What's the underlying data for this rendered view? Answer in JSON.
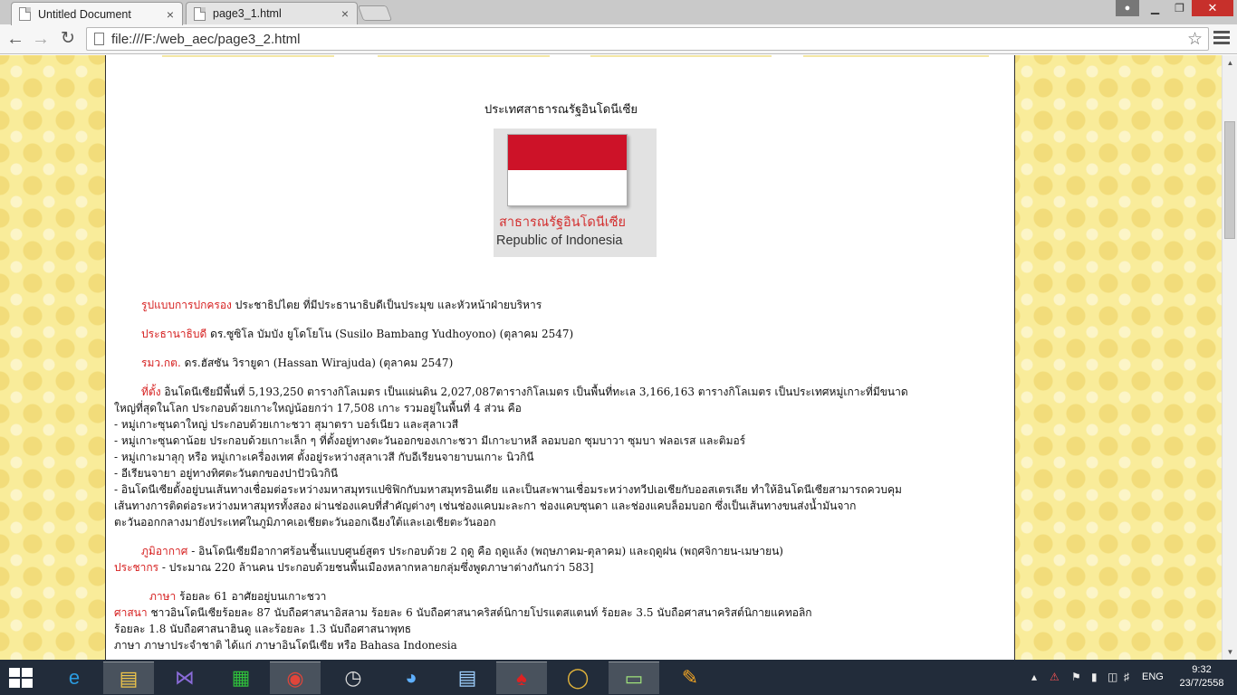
{
  "browser": {
    "tabs": [
      {
        "title": "Untitled Document",
        "active": true
      },
      {
        "title": "page3_1.html",
        "active": false
      }
    ],
    "tab_close": "×",
    "address": "file:///F:/web_aec/page3_2.html",
    "window_user_icon": "user-icon",
    "window_buttons": {
      "minimize": "▁",
      "maximize": "❐",
      "close": "✕"
    }
  },
  "page": {
    "country_title": "ประเทศสาธารณรัฐอินโดนีเซีย",
    "flag": {
      "colors": {
        "top": "#cd1228",
        "bottom": "#ffffff"
      },
      "caption_th": "สาธารณรัฐอินโดนีเซีย",
      "caption_en": "Republic of Indonesia"
    },
    "government": {
      "label": "รูปแบบการปกครอง",
      "text": " ประชาธิปไตย  ที่มีประธานาธิบดีเป็นประมุข  และหัวหน้าฝ่ายบริหาร"
    },
    "president": {
      "label": "ประธานาธิบดี",
      "text": "  ดร.ซูซิโล  บัมบัง  ยูโดโยโน  (Susilo  Bambang  Yudhoyono)  (ตุลาคม  2547)"
    },
    "foreign_minister": {
      "label": "รมว.กต.",
      "text": "  ดร.ฮัสซัน  วิรายูดา  (Hassan  Wirajuda)  (ตุลาคม  2547)"
    },
    "location": {
      "label": "ที่ตั้ง",
      "lines": [
        "  อินโดนีเซียมีพื้นที่  5,193,250  ตารางกิโลเมตร  เป็นแผ่นดิน  2,027,087ตารางกิโลเมตร  เป็นพื้นที่ทะเล  3,166,163  ตารางกิโลเมตร  เป็นประเทศหมู่เกาะที่มีขนาด",
        "ใหญ่ที่สุดในโลก  ประกอบด้วยเกาะใหญ่น้อยกว่า  17,508  เกาะ  รวมอยู่ในพื้นที่  4  ส่วน  คือ",
        "-  หมู่เกาะซุนดาใหญ่  ประกอบด้วยเกาะชวา  สุมาตรา  บอร์เนียว  และสุลาเวสี",
        "-  หมู่เกาะซุนดาน้อย  ประกอบด้วยเกาะเล็ก  ๆ  ที่ตั้งอยู่ทางตะวันออกของเกาะชวา  มีเกาะบาหลี  ลอมบอก  ซุมบาวา  ซุมบา  ฟลอเรส  และติมอร์",
        "-  หมู่เกาะมาลุกุ  หรือ  หมู่เกาะเครื่องเทศ  ตั้งอยู่ระหว่างสุลาเวสี  กับอีเรียนจายาบนเกาะ  นิวกินี",
        "-  อีเรียนจายา  อยู่ทางทิศตะวันตกของปาปัวนิวกินี",
        "-  อินโดนีเซียตั้งอยู่บนเส้นทางเชื่อมต่อระหว่างมหาสมุทรแปซิฟิกกับมหาสมุทรอินเดีย  และเป็นสะพานเชื่อมระหว่างทวีปเอเชียกับออสเตรเลีย  ทำให้อินโดนีเซียสามารถควบคุม",
        "เส้นทางการติดต่อระหว่างมหาสมุทรทั้งสอง  ผ่านช่องแคบที่สำคัญต่างๆ  เช่นช่องแคบมะละกา  ช่องแคบซุนดา  และช่องแคบล็อมบอก  ซึ่งเป็นเส้นทางขนส่งน้ำมันจาก",
        "ตะวันออกกลางมายังประเทศในภูมิภาคเอเชียตะวันออกเฉียงใต้และเอเชียตะวันออก"
      ]
    },
    "climate": {
      "label": "ภูมิอากาศ",
      "text": "  -  อินโดนีเซียมีอากาศร้อนชื้นแบบศูนย์สูตร  ประกอบด้วย  2  ฤดู  คือ  ฤดูแล้ง  (พฤษภาคม-ตุลาคม)  และฤดูฝน  (พฤศจิกายน-เมษายน)"
    },
    "population": {
      "label": "ประชากร",
      "text": "  -  ประมาณ  220  ล้านคน  ประกอบด้วยชนพื้นเมืองหลากหลายกลุ่มซึ่งพูดภาษาต่างกันกว่า  583]"
    },
    "language": {
      "label": "ภาษา",
      "text": "  ร้อยละ  61  อาศัยอยู่บนเกาะชวา"
    },
    "religion": {
      "label": "ศาสนา",
      "lines": [
        "  ชาวอินโดนีเซียร้อยละ  87  นับถือศาสนาอิสลาม  ร้อยละ  6  นับถือศาสนาคริสต์นิกายโปรแตสแตนท์  ร้อยละ  3.5  นับถือศาสนาคริสต์นิกายแคทอลิก",
        "ร้อยละ  1.8  นับถือศาสนาฮินดู  และร้อยละ  1.3  นับถือศาสนาพุทธ",
        "ภาษา  ภาษาประจำชาติ  ได้แก่  ภาษาอินโดนีเซีย  หรือ  Bahasa  Indonesia"
      ]
    },
    "accent_color": "#d62020"
  },
  "taskbar": {
    "apps": [
      "file-explorer-icon",
      "internet-explorer-icon",
      "visual-studio-icon",
      "store-icon",
      "chrome-icon",
      "clock-app-icon",
      "browser-app-icon",
      "task-manager-icon",
      "game-icon",
      "hon-game-icon",
      "drive-icon",
      "paint-icon"
    ],
    "language": "ENG",
    "time": "9:32",
    "date": "23/7/2558"
  }
}
